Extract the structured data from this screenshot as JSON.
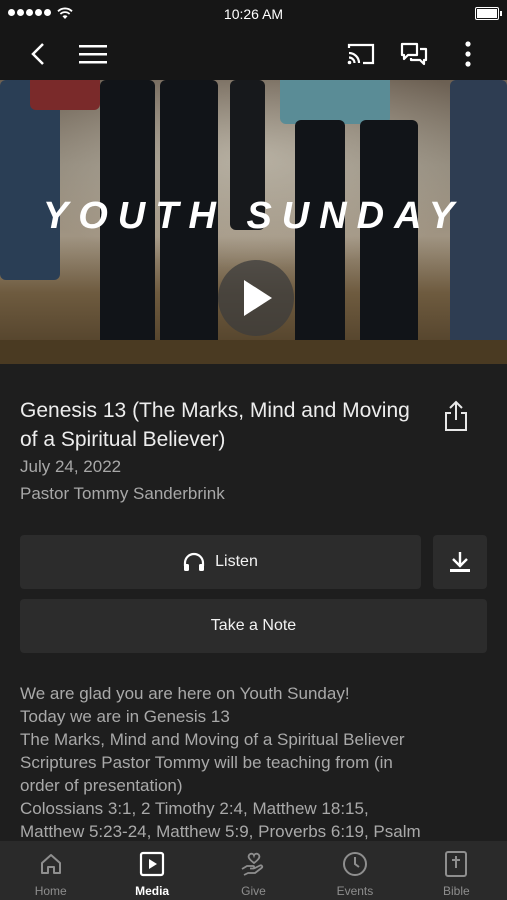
{
  "status_bar": {
    "time": "10:26 AM"
  },
  "hero": {
    "title_text": "YOUTH SUNDAY"
  },
  "sermon": {
    "title": "Genesis 13 (The Marks, Mind and Moving of a Spiritual Believer)",
    "date": "July 24, 2022",
    "speaker": "Pastor Tommy Sanderbrink"
  },
  "actions": {
    "listen_label": "Listen",
    "take_note_label": "Take a Note"
  },
  "description": [
    "We are glad you are here on Youth Sunday!",
    "Today we are in Genesis 13",
    "The Marks, Mind and Moving of a Spiritual Believer",
    "Scriptures Pastor Tommy will be teaching from (in",
    "order of presentation)",
    "Colossians 3:1, 2 Timothy 2:4, Matthew 18:15,",
    "Matthew 5:23-24, Matthew 5:9, Proverbs 6:19, Psalm"
  ],
  "tabs": [
    {
      "label": "Home",
      "icon": "home-icon",
      "active": false
    },
    {
      "label": "Media",
      "icon": "media-icon",
      "active": true
    },
    {
      "label": "Give",
      "icon": "give-icon",
      "active": false
    },
    {
      "label": "Events",
      "icon": "events-icon",
      "active": false
    },
    {
      "label": "Bible",
      "icon": "bible-icon",
      "active": false
    }
  ],
  "colors": {
    "background": "#1e1e1e",
    "button": "#2c2c2c",
    "tabbar": "#2a2a2a",
    "muted_text": "#a8a8a8"
  }
}
